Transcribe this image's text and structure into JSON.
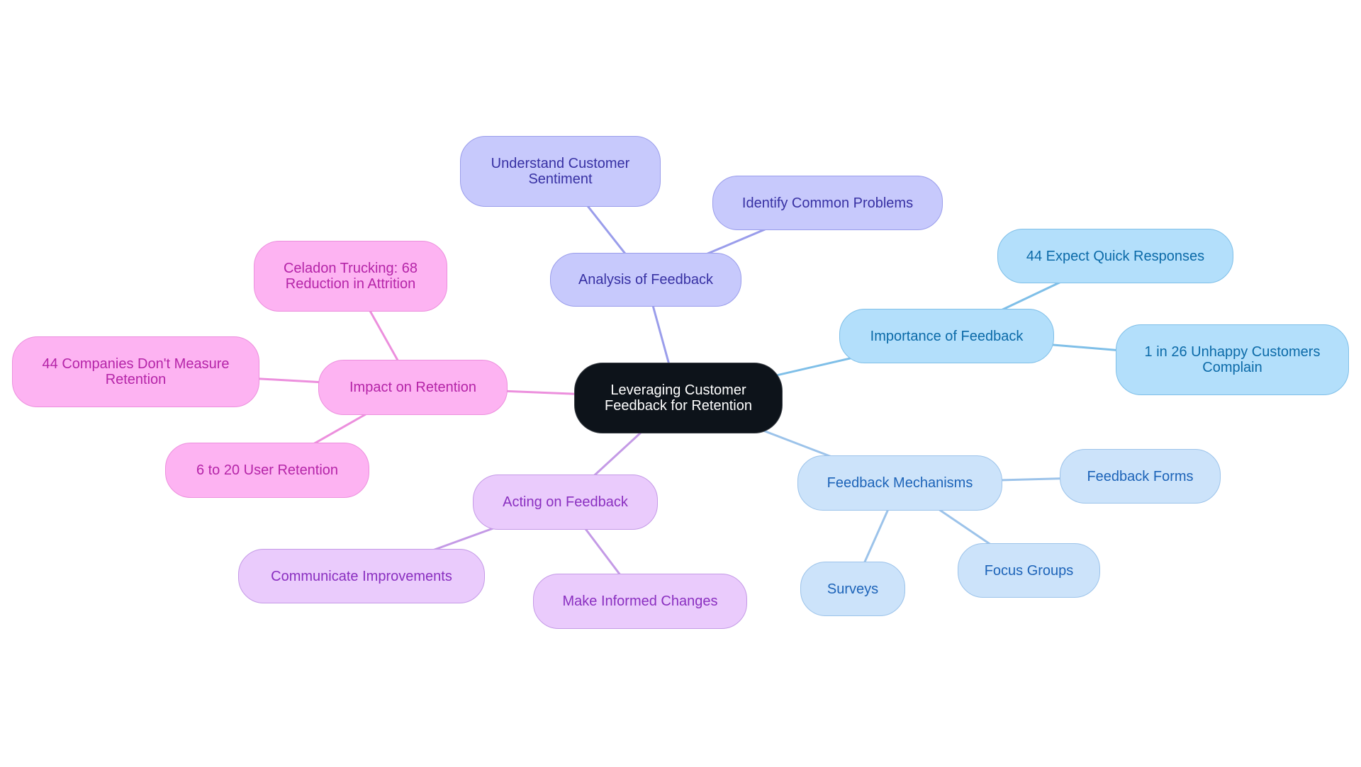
{
  "diagram": {
    "type": "mindmap",
    "root": {
      "id": "root",
      "label": "Leveraging Customer Feedback for Retention"
    },
    "branches": [
      {
        "id": "analysis",
        "label": "Analysis of Feedback",
        "color": "#9a9deb",
        "children": [
          {
            "id": "sentiment",
            "label": "Understand Customer Sentiment"
          },
          {
            "id": "problems",
            "label": "Identify Common Problems"
          }
        ]
      },
      {
        "id": "importance",
        "label": "Importance of Feedback",
        "color": "#7fbfe8",
        "children": [
          {
            "id": "quick",
            "label": "44 Expect Quick Responses"
          },
          {
            "id": "unhappy",
            "label": "1 in 26 Unhappy Customers Complain"
          }
        ]
      },
      {
        "id": "mechanisms",
        "label": "Feedback Mechanisms",
        "color": "#9cc3ea",
        "children": [
          {
            "id": "forms",
            "label": "Feedback Forms"
          },
          {
            "id": "focus",
            "label": "Focus Groups"
          },
          {
            "id": "surveys",
            "label": "Surveys"
          }
        ]
      },
      {
        "id": "acting",
        "label": "Acting on Feedback",
        "color": "#c49ae6",
        "children": [
          {
            "id": "communicate",
            "label": "Communicate Improvements"
          },
          {
            "id": "changes",
            "label": "Make Informed Changes"
          }
        ]
      },
      {
        "id": "impact",
        "label": "Impact on Retention",
        "color": "#ec8fdd",
        "children": [
          {
            "id": "celadon",
            "label": "Celadon Trucking: 68 Reduction in Attrition"
          },
          {
            "id": "measure",
            "label": "44 Companies Don't Measure Retention"
          },
          {
            "id": "user",
            "label": "6 to 20 User Retention"
          }
        ]
      }
    ]
  }
}
